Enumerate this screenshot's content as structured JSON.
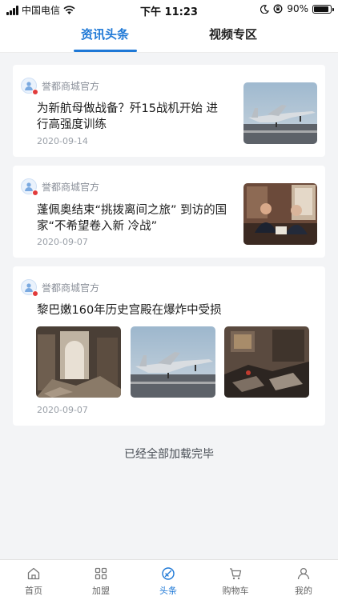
{
  "status_bar": {
    "carrier": "中国电信",
    "time": "下午 11:23",
    "battery": "90%",
    "battery_level": 0.9
  },
  "tabs": [
    {
      "label": "资讯头条",
      "active": true
    },
    {
      "label": "视频专区",
      "active": false
    }
  ],
  "articles": [
    {
      "source": "誉都商城官方",
      "title": "为新航母做战备？歼15战机开始 进行高强度训练",
      "date": "2020-09-14"
    },
    {
      "source": "誉都商城官方",
      "title": "蓬佩奥结束“挑拨离间之旅” 到访的国家“不希望卷入新 冷战”",
      "date": "2020-09-07"
    },
    {
      "source": "誉都商城官方",
      "title": "黎巴嫩160年历史宫殿在爆炸中受损",
      "date": "2020-09-07"
    }
  ],
  "footer_text": "已经全部加载完毕",
  "bottom_nav": [
    {
      "label": "首页",
      "icon": "home-icon"
    },
    {
      "label": "加盟",
      "icon": "grid-icon"
    },
    {
      "label": "头条",
      "icon": "headline-icon",
      "active": true
    },
    {
      "label": "购物车",
      "icon": "cart-icon"
    },
    {
      "label": "我的",
      "icon": "user-icon"
    }
  ],
  "colors": {
    "accent": "#1e78d6",
    "background": "#f3f4f6",
    "badge": "#e23b3b"
  }
}
